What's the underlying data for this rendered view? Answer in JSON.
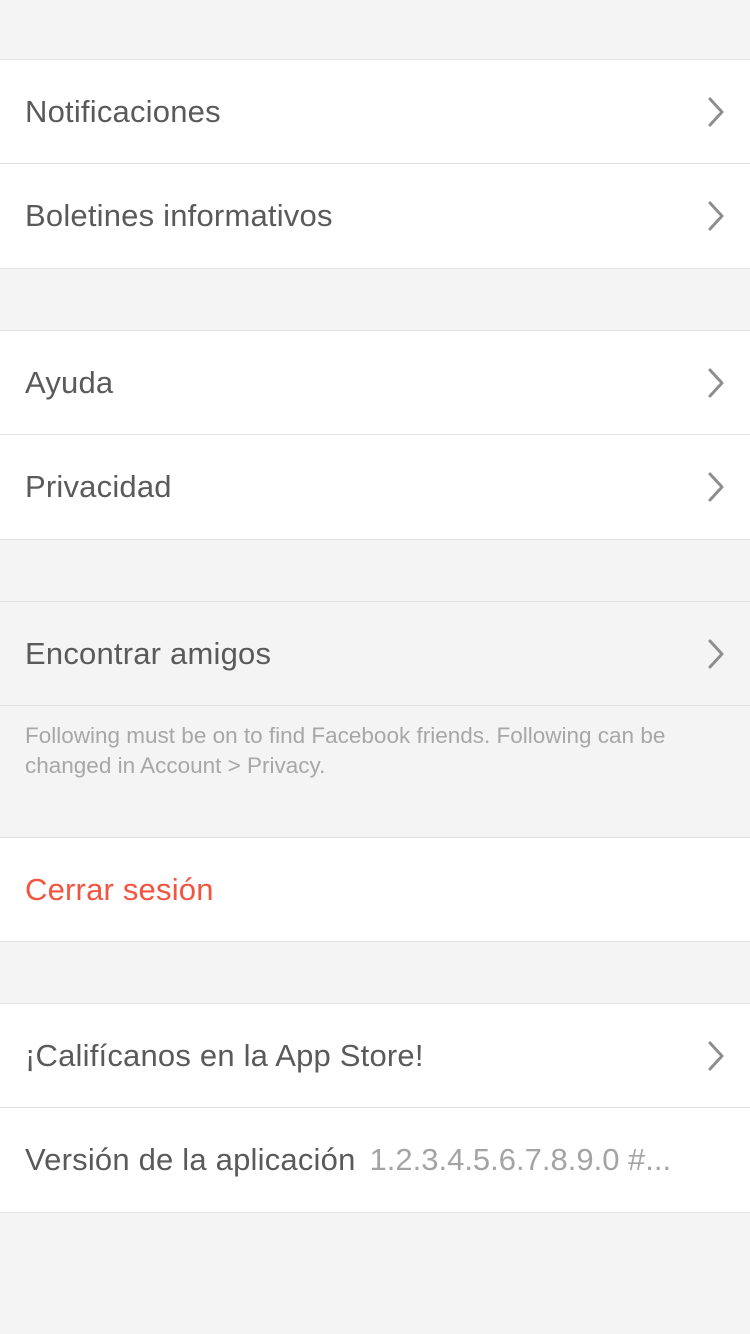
{
  "colors": {
    "background": "#f4f4f4",
    "row": "#ffffff",
    "text": "#5a5a5a",
    "danger": "#f2553f",
    "muted": "#a7a7a7",
    "divider": "#e2e2e2"
  },
  "settings": {
    "notifications_label": "Notificaciones",
    "newsletters_label": "Boletines informativos",
    "help_label": "Ayuda",
    "privacy_label": "Privacidad",
    "find_friends_label": "Encontrar amigos",
    "find_friends_note": "Following must be on to find Facebook friends. Following can be changed in Account > Privacy.",
    "logout_label": "Cerrar sesión",
    "rate_label": "¡Califícanos en la App Store!",
    "version_label": "Versión de la aplicación",
    "version_value": "1.2.3.4.5.6.7.8.9.0 #..."
  },
  "icons": {
    "row_arrow": "chevron-right-icon"
  }
}
